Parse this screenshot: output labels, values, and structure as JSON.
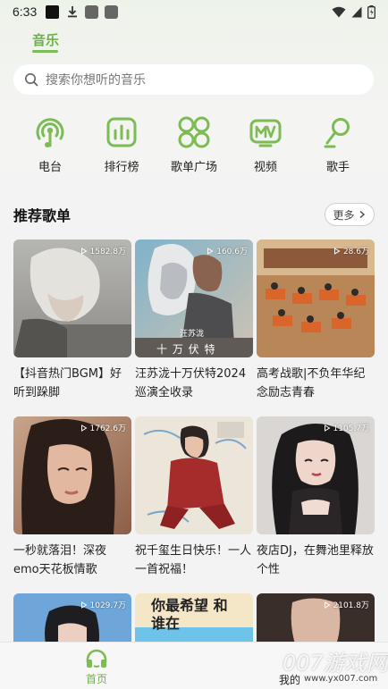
{
  "status_bar": {
    "time": "6:33"
  },
  "top_tabs": [
    {
      "label": "音乐",
      "active": true
    }
  ],
  "search": {
    "placeholder": "搜索你想听的音乐"
  },
  "nav_items": [
    {
      "label": "电台",
      "icon": "radio-icon"
    },
    {
      "label": "排行榜",
      "icon": "chart-bars-icon"
    },
    {
      "label": "歌单广场",
      "icon": "grid-circles-icon"
    },
    {
      "label": "视频",
      "icon": "mv-icon"
    },
    {
      "label": "歌手",
      "icon": "singer-mic-icon"
    }
  ],
  "section": {
    "title": "推荐歌单",
    "more_label": "更多"
  },
  "cover_texts": {
    "card2_name": "汪苏泷",
    "card2_caption": "十 万 伏 特",
    "card7_text": "你最希望 和谁在"
  },
  "playlists": [
    {
      "title": "【抖音热门BGM】好听到跺脚",
      "plays": "1582.8万"
    },
    {
      "title": "汪苏泷十万伏特2024巡演全收录",
      "plays": "160.6万"
    },
    {
      "title": "高考战歌|不负年华纪念励志青春",
      "plays": "28.6万"
    },
    {
      "title": "一秒就落泪！深夜emo天花板情歌",
      "plays": "1762.6万"
    },
    {
      "title": "祝千玺生日快乐！一人一首祝福！",
      "plays": ""
    },
    {
      "title": "夜店DJ，在舞池里释放个性",
      "plays": "1105.7万"
    },
    {
      "title": "",
      "plays": "1029.7万"
    },
    {
      "title": "",
      "plays": ""
    },
    {
      "title": "",
      "plays": "2101.8万"
    }
  ],
  "bottom_nav": {
    "home_label": "首页",
    "mine_label": "我的"
  },
  "watermark": {
    "text": "007游戏网",
    "url": "www.yx007.com"
  },
  "colors": {
    "accent": "#7dbb54",
    "accent_text": "#6fb04b"
  }
}
